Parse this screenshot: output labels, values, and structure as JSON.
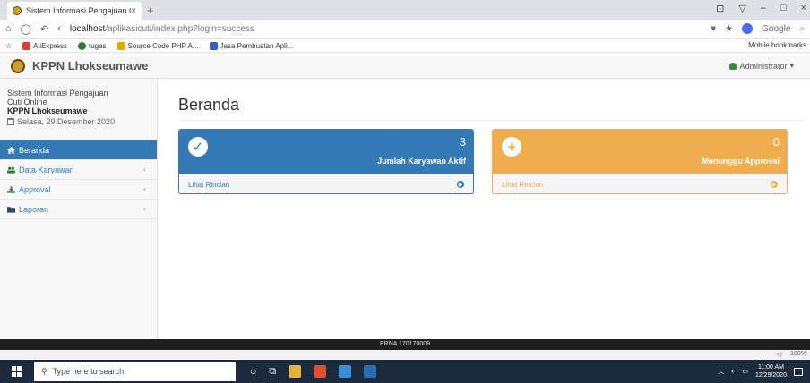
{
  "browser": {
    "tab_title": "Sistem Informasi Pengajuan C",
    "tab_close": "×",
    "new_tab": "+",
    "window_controls": [
      "⊡",
      "▽",
      "–",
      "□",
      "×"
    ],
    "nav_buttons": [
      "⌂",
      "◯",
      "↶",
      "‹"
    ],
    "url_host": "localhost",
    "url_path": "/aplikasicuti/index.php?login=success",
    "addr_right_icons": [
      "♥",
      "★"
    ],
    "search_engine": "Google",
    "search_button": "⌕",
    "bookmarks": [
      {
        "label": "AliExpress",
        "color": "#e33c2b"
      },
      {
        "label": "tugas",
        "color": "#2f7d32"
      },
      {
        "label": "Source Code PHP A...",
        "color": "#e6a700"
      },
      {
        "label": "Jasa Pembuatan Apli...",
        "color": "#2a64c9"
      }
    ],
    "bookmarks_star": "☆",
    "mobile_bookmarks": "Mobile bookmarks"
  },
  "app": {
    "brand": "KPPN Lhokseumawe",
    "user": "Administrator"
  },
  "sidebar": {
    "heading_line1": "Sistem Informasi Pengajuan",
    "heading_line2": "Cuti Online",
    "heading_bold": "KPPN Lhokseumawe",
    "date": "Selasa, 29 Desember 2020",
    "items": [
      {
        "label": "Beranda",
        "active": true,
        "chevron": ""
      },
      {
        "label": "Data Karyawan",
        "active": false,
        "chevron": "‹"
      },
      {
        "label": "Approval",
        "active": false,
        "chevron": "‹"
      },
      {
        "label": "Laporan",
        "active": false,
        "chevron": "‹"
      }
    ]
  },
  "main": {
    "title": "Beranda",
    "panels": [
      {
        "number": "3",
        "label": "Jumlah Karyawan Aktif",
        "link": "Lihat Rincian",
        "icon": "check-circle-icon",
        "color": "#337ab7"
      },
      {
        "number": "0",
        "label": "Menunggu Approval",
        "link": "Lihat Rincian",
        "icon": "plus-circle-icon",
        "color": "#f0ad4e"
      }
    ]
  },
  "footer": {
    "text": "ERNA 170170009"
  },
  "statusbar": {
    "zoom": "100%"
  },
  "taskbar": {
    "search_placeholder": "Type here to search",
    "time": "11:00 AM",
    "date": "12/29/2020"
  }
}
